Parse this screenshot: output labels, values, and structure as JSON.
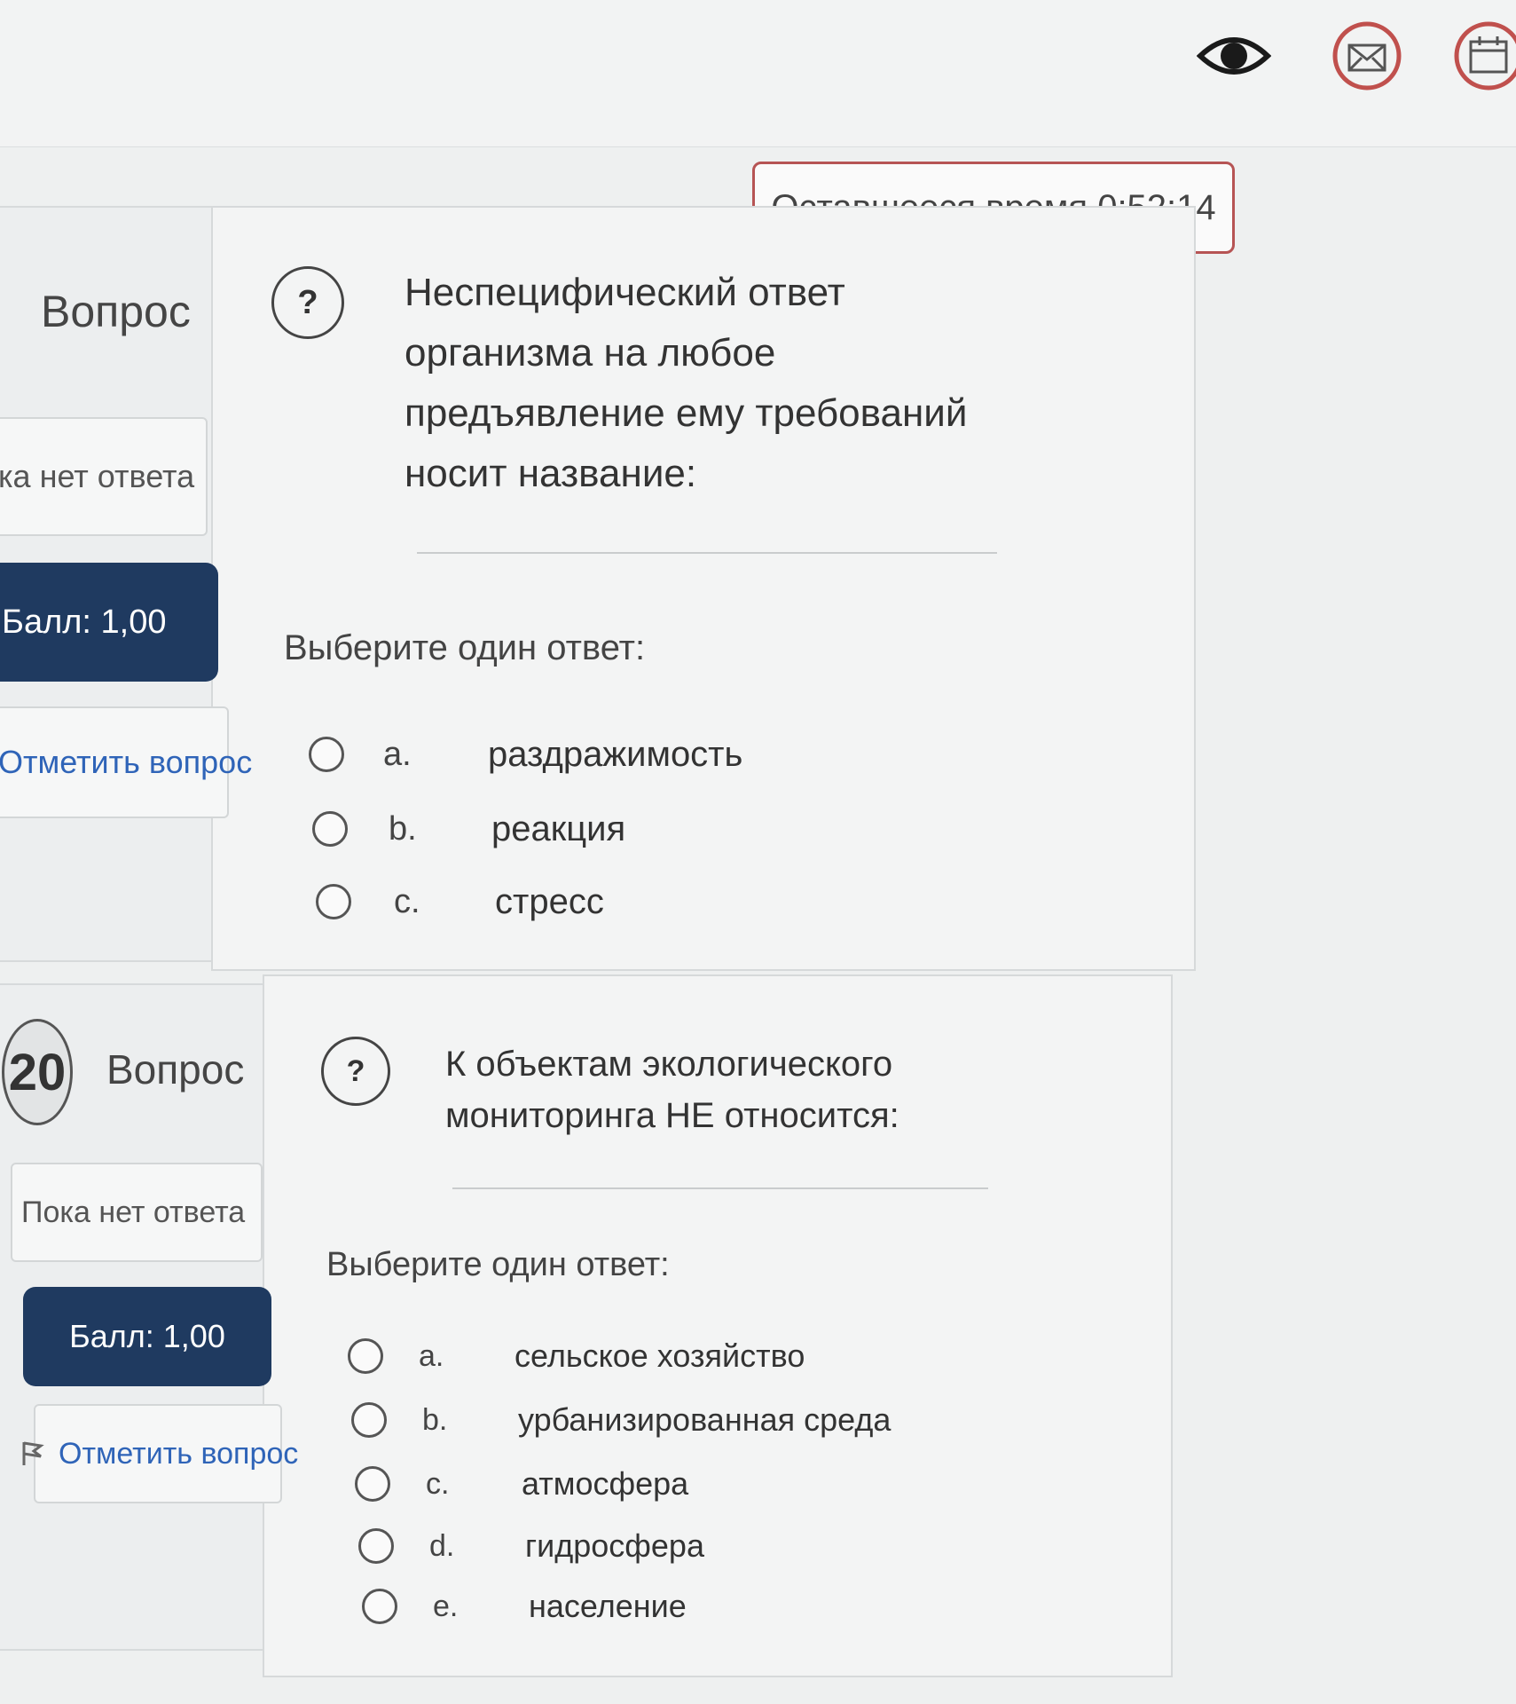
{
  "timer": {
    "label": "Оставшееся время 0:52:14"
  },
  "question19": {
    "label": "Вопрос",
    "state": "ка нет ответа",
    "grade": "Балл: 1,00",
    "flag": "Отметить вопрос",
    "text": "Неспецифический ответ организма на любое предъявление ему требований носит название:",
    "prompt": "Выберите один ответ:",
    "options": [
      {
        "letter": "a.",
        "text": "раздражимость"
      },
      {
        "letter": "b.",
        "text": "реакция"
      },
      {
        "letter": "c.",
        "text": "стресс"
      }
    ]
  },
  "question20": {
    "number": "20",
    "label": "Вопрос",
    "state": "Пока нет ответа",
    "grade": "Балл: 1,00",
    "flag": "Отметить вопрос",
    "text": "К объектам экологического мониторинга НЕ относится:",
    "prompt": "Выберите один ответ:",
    "options": [
      {
        "letter": "a.",
        "text": "сельское хозяйство"
      },
      {
        "letter": "b.",
        "text": "урбанизированная среда"
      },
      {
        "letter": "c.",
        "text": "атмосфера"
      },
      {
        "letter": "d.",
        "text": "гидросфера"
      },
      {
        "letter": "e.",
        "text": "население"
      }
    ]
  },
  "icons": {
    "top": [
      "eye-icon",
      "message-icon",
      "calendar-icon"
    ],
    "help": "help-icon",
    "flag": "flag-icon"
  },
  "colors": {
    "grade_bg": "#1f3a60",
    "timer_border": "#b65454",
    "flag_link": "#2f64b8",
    "icon_accent": "#c0504d"
  }
}
